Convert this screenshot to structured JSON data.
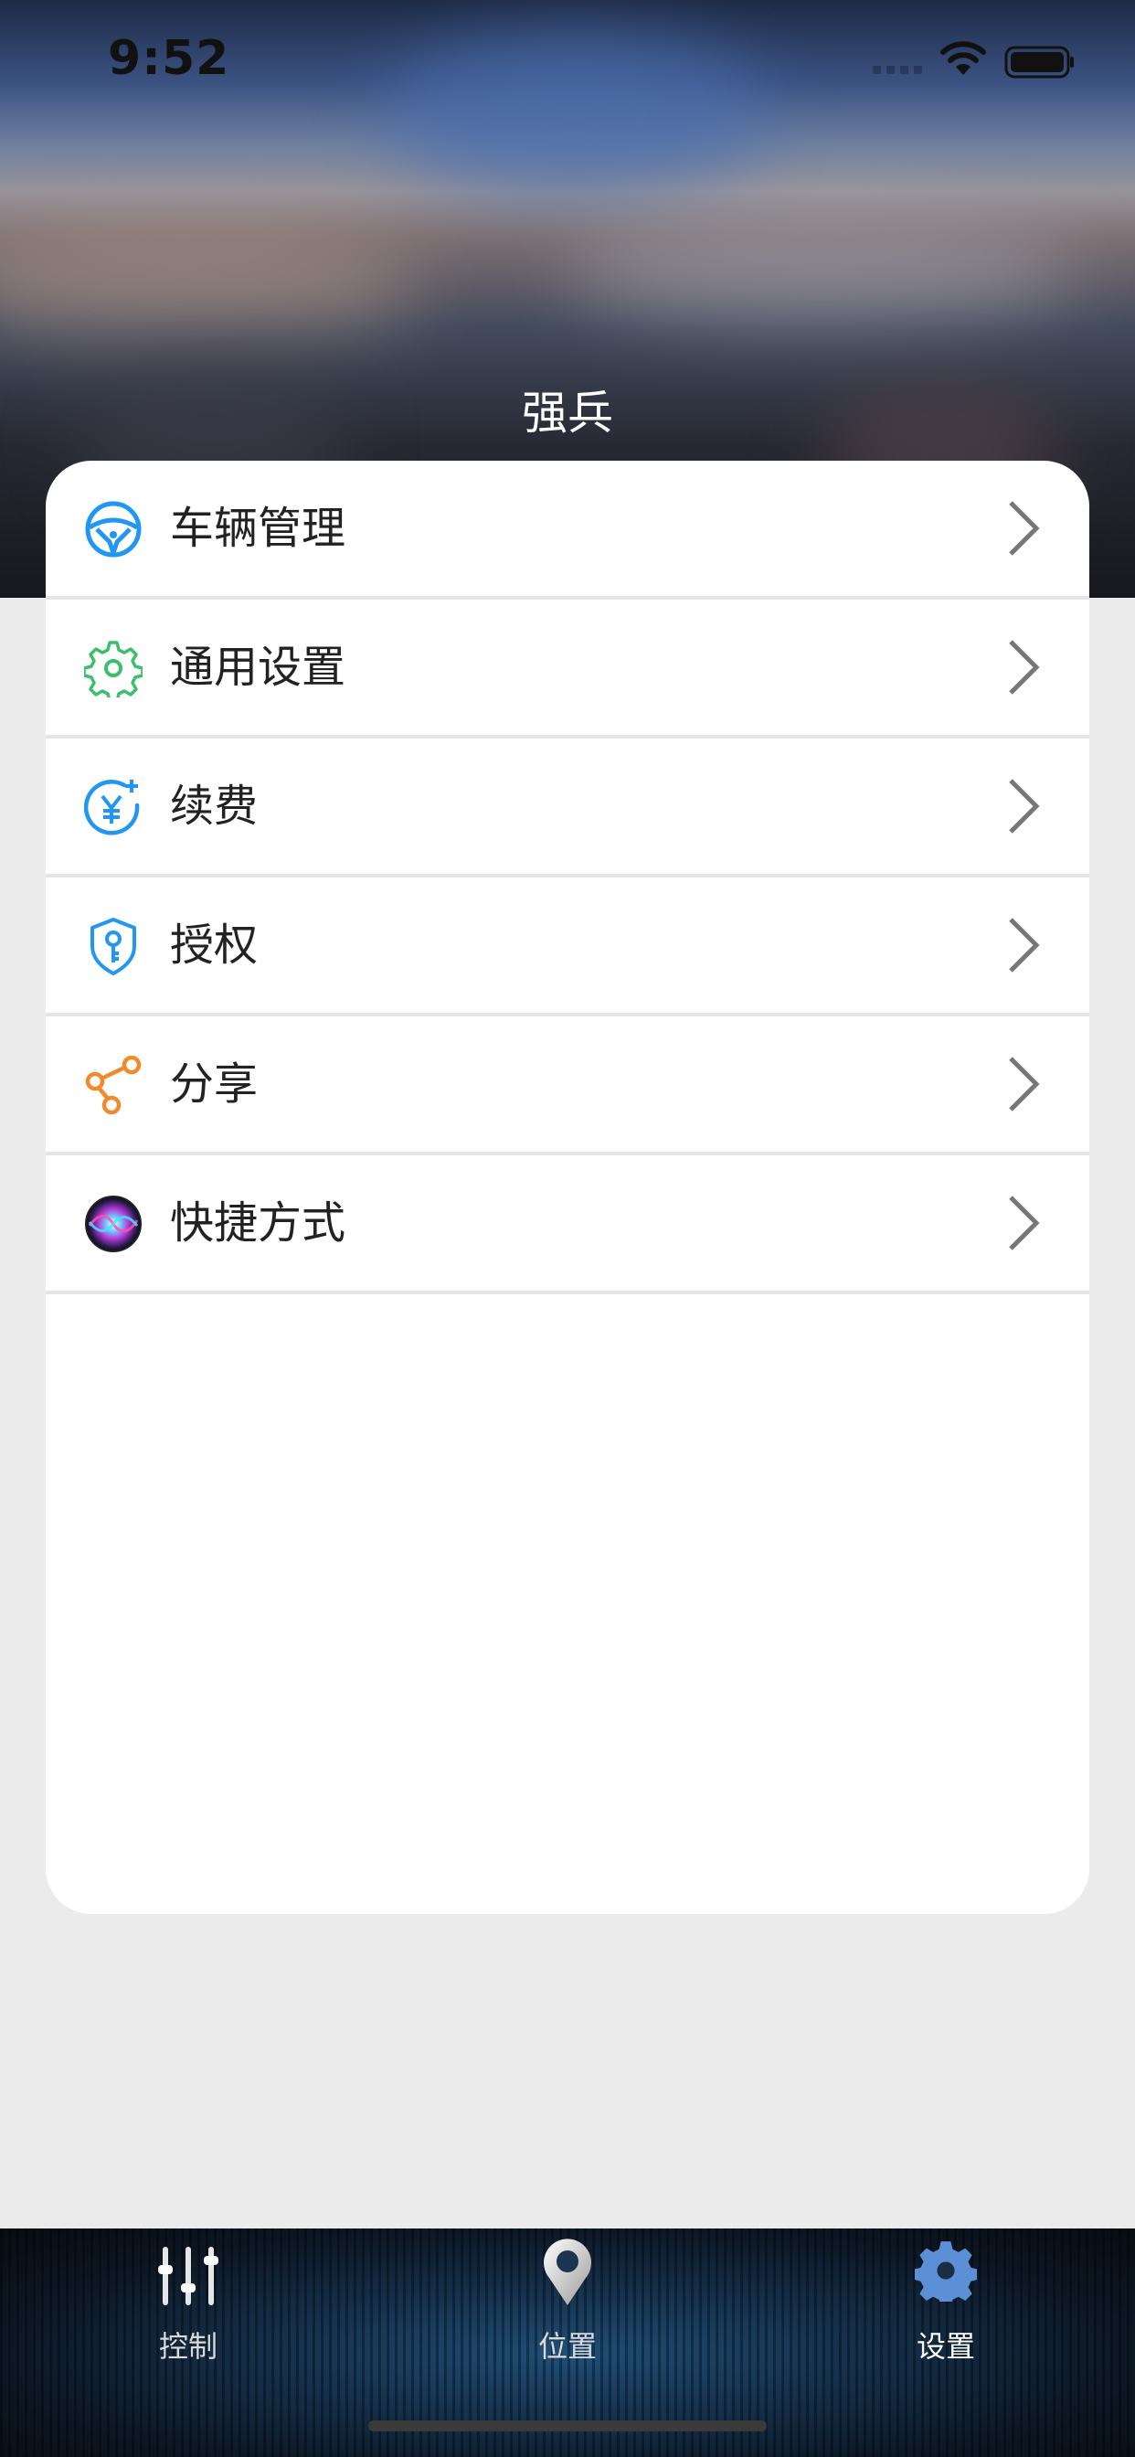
{
  "status_bar": {
    "time": "9:52"
  },
  "header": {
    "username": "强兵"
  },
  "menu": {
    "items": [
      {
        "label": "车辆管理",
        "icon": "steering-wheel-icon",
        "color": "#2196f3"
      },
      {
        "label": "通用设置",
        "icon": "gear-icon",
        "color": "#3cbf6b"
      },
      {
        "label": "续费",
        "icon": "yuan-renew-icon",
        "color": "#2196f3"
      },
      {
        "label": "授权",
        "icon": "shield-key-icon",
        "color": "#2196f3"
      },
      {
        "label": "分享",
        "icon": "share-icon",
        "color": "#f08a2c"
      },
      {
        "label": "快捷方式",
        "icon": "siri-icon",
        "color": "#8a3fd1"
      }
    ]
  },
  "tabbar": {
    "tabs": [
      {
        "label": "控制",
        "icon": "sliders-icon",
        "active": false
      },
      {
        "label": "位置",
        "icon": "location-pin-icon",
        "active": false
      },
      {
        "label": "设置",
        "icon": "gear-icon",
        "active": true
      }
    ],
    "active_color": "#5b8fd6"
  }
}
